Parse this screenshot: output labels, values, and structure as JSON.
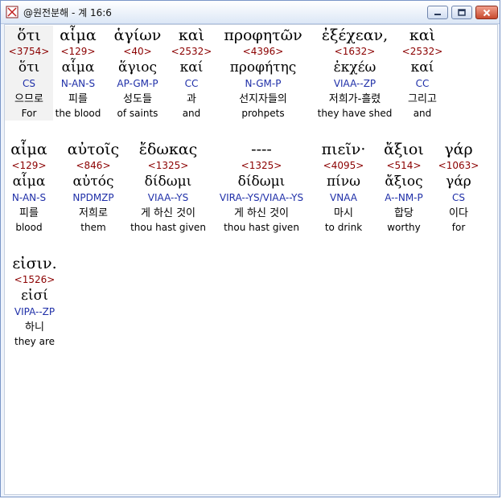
{
  "window": {
    "title": "@원전분해 - 계 16:6",
    "min_label": "minimize",
    "max_label": "maximize",
    "close_label": "close"
  },
  "words": [
    {
      "greek": "ὅτι",
      "strong": "<3754>",
      "lemma": "ὅτι",
      "parse": "CS",
      "korean": "으므로",
      "english": "For"
    },
    {
      "greek": "αἷμα",
      "strong": "<129>",
      "lemma": "αἷμα",
      "parse": "N-AN-S",
      "korean": "피를",
      "english": "the blood"
    },
    {
      "greek": "ἁγίων",
      "strong": "<40>",
      "lemma": "ἅγιος",
      "parse": "AP-GM-P",
      "korean": "성도들",
      "english": "of saints"
    },
    {
      "greek": "καὶ",
      "strong": "<2532>",
      "lemma": "καί",
      "parse": "CC",
      "korean": "과",
      "english": "and"
    },
    {
      "greek": "προφητῶν",
      "strong": "<4396>",
      "lemma": "προφήτης",
      "parse": "N-GM-P",
      "korean": "선지자들의",
      "english": "prohpets"
    },
    {
      "greek": "ἐξέχεαν,",
      "strong": "<1632>",
      "lemma": "ἐκχέω",
      "parse": "VIAA--ZP",
      "korean": "저희가-흘렸",
      "english": "they have shed"
    },
    {
      "greek": "καὶ",
      "strong": "<2532>",
      "lemma": "καί",
      "parse": "CC",
      "korean": "그리고",
      "english": "and"
    },
    {
      "greek": "αἷμα",
      "strong": "<129>",
      "lemma": "αἷμα",
      "parse": "N-AN-S",
      "korean": "피를",
      "english": "blood"
    },
    {
      "greek": "αὐτοῖς",
      "strong": "<846>",
      "lemma": "αὐτός",
      "parse": "NPDMZP",
      "korean": "저희로",
      "english": "them"
    },
    {
      "greek": "ἔδωκας",
      "strong": "<1325>",
      "lemma": "δίδωμι",
      "parse": "VIAA--YS",
      "korean": "게 하신 것이",
      "english": "thou hast given"
    },
    {
      "greek": "----",
      "strong": "<1325>",
      "lemma": "δίδωμι",
      "parse": "VIRA--YS/VIAA--YS",
      "korean": "게 하신 것이",
      "english": "thou hast given"
    },
    {
      "greek": "πιεῖν·",
      "strong": "<4095>",
      "lemma": "πίνω",
      "parse": "VNAA",
      "korean": "마시",
      "english": "to drink"
    },
    {
      "greek": "ἄξιοι",
      "strong": "<514>",
      "lemma": "ἄξιος",
      "parse": "A--NM-P",
      "korean": "합당",
      "english": "worthy"
    },
    {
      "greek": "γάρ",
      "strong": "<1063>",
      "lemma": "γάρ",
      "parse": "CS",
      "korean": "이다",
      "english": "for"
    },
    {
      "greek": "εἰσιν.",
      "strong": "<1526>",
      "lemma": "εἰσί",
      "parse": "VIPA--ZP",
      "korean": "하니",
      "english": "they are"
    }
  ],
  "colors": {
    "strong": "#8b0000",
    "parse": "#1f2fa8",
    "highlight": "#f2f2f2"
  }
}
